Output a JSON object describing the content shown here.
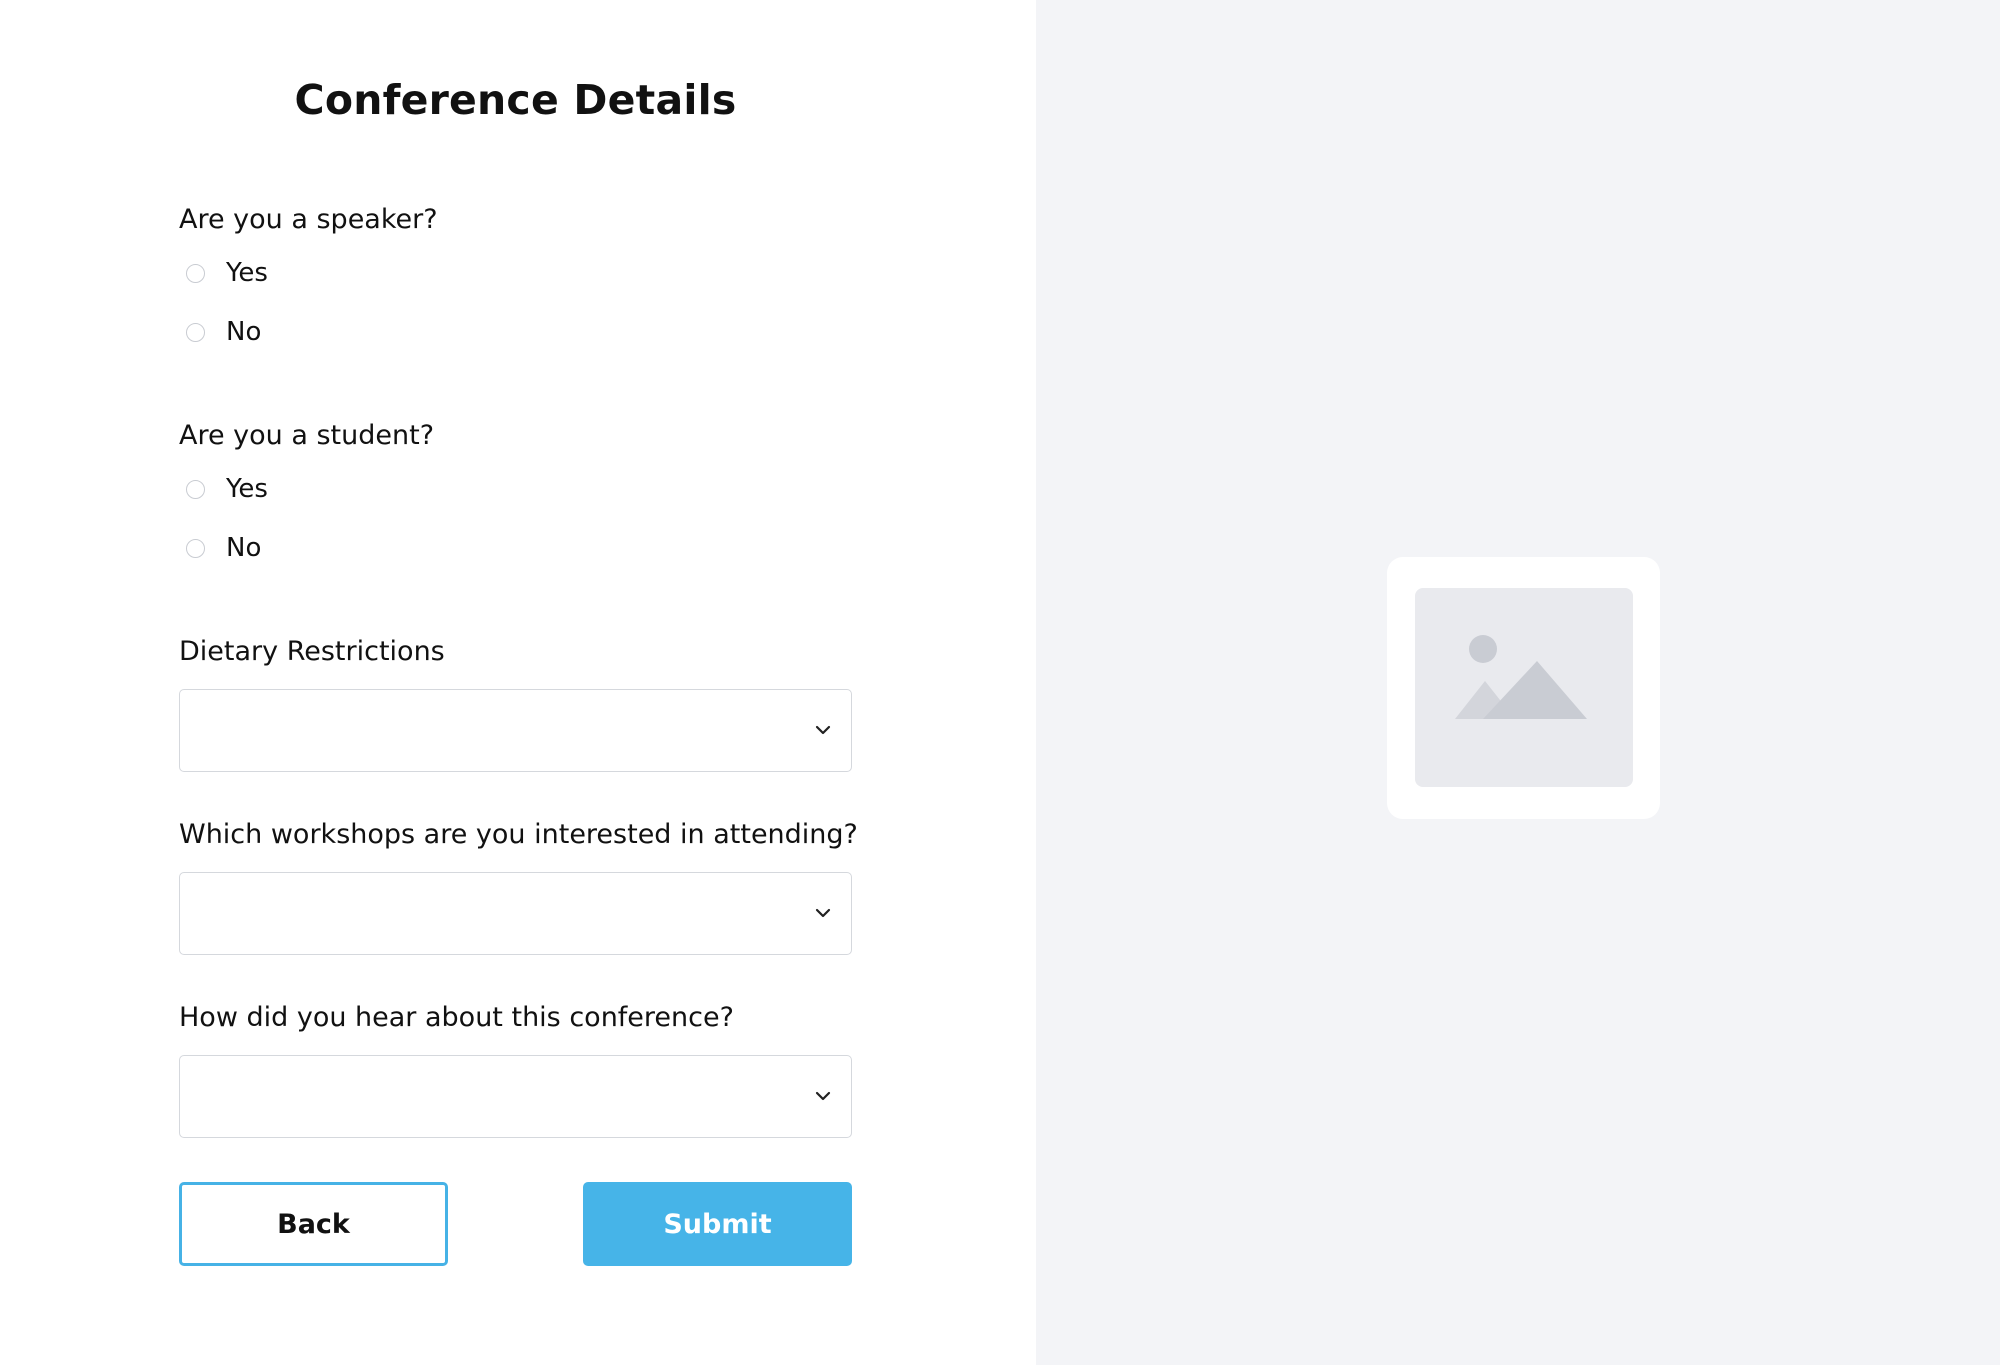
{
  "form": {
    "title": "Conference Details",
    "speaker": {
      "question": "Are you a speaker?",
      "options": [
        "Yes",
        "No"
      ]
    },
    "student": {
      "question": "Are you a student?",
      "options": [
        "Yes",
        "No"
      ]
    },
    "dietary": {
      "label": "Dietary Restrictions",
      "value": ""
    },
    "workshops": {
      "label": "Which workshops are you interested in attending?",
      "value": ""
    },
    "referral": {
      "label": "How did you hear about this conference?",
      "value": ""
    },
    "buttons": {
      "back": "Back",
      "submit": "Submit"
    }
  },
  "icons": {
    "select_chevron": "chevron-down-icon",
    "placeholder": "image-placeholder-icon"
  },
  "colors": {
    "accent": "#46b4e8",
    "right_panel_bg": "#f3f4f7",
    "placeholder_frame": "#e9eaee",
    "placeholder_shapes": "#c9ccd3"
  }
}
